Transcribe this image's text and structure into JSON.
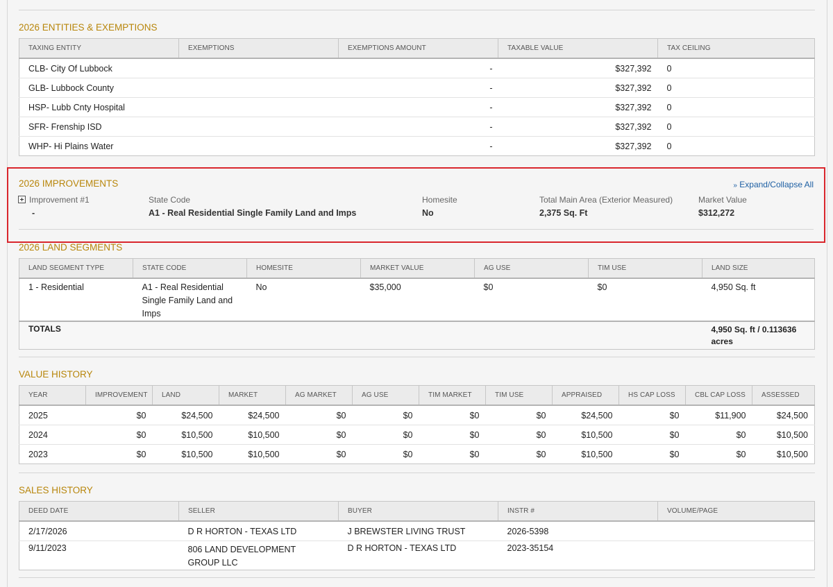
{
  "entities": {
    "title": "2026 ENTITIES & EXEMPTIONS",
    "headers": [
      "TAXING ENTITY",
      "EXEMPTIONS",
      "EXEMPTIONS AMOUNT",
      "TAXABLE VALUE",
      "TAX CEILING"
    ],
    "rows": [
      {
        "entity": "CLB- City Of Lubbock",
        "exemptions": "",
        "amount": "-",
        "taxable": "$327,392",
        "ceiling": "0"
      },
      {
        "entity": "GLB- Lubbock County",
        "exemptions": "",
        "amount": "-",
        "taxable": "$327,392",
        "ceiling": "0"
      },
      {
        "entity": "HSP- Lubb Cnty Hospital",
        "exemptions": "",
        "amount": "-",
        "taxable": "$327,392",
        "ceiling": "0"
      },
      {
        "entity": "SFR- Frenship ISD",
        "exemptions": "",
        "amount": "-",
        "taxable": "$327,392",
        "ceiling": "0"
      },
      {
        "entity": "WHP- Hi Plains Water",
        "exemptions": "",
        "amount": "-",
        "taxable": "$327,392",
        "ceiling": "0"
      }
    ]
  },
  "improvements": {
    "title": "2026 IMPROVEMENTS",
    "expand_label": "Expand/Collapse All",
    "fields": [
      {
        "label": "Improvement #1",
        "value": "-"
      },
      {
        "label": "State Code",
        "value": "A1 - Real Residential Single Family Land and Imps"
      },
      {
        "label": "Homesite",
        "value": "No"
      },
      {
        "label": "Total Main Area (Exterior Measured)",
        "value": "2,375 Sq. Ft"
      },
      {
        "label": "Market Value",
        "value": "$312,272"
      }
    ]
  },
  "land": {
    "title": "2026 LAND SEGMENTS",
    "headers": [
      "LAND SEGMENT TYPE",
      "STATE CODE",
      "HOMESITE",
      "MARKET VALUE",
      "AG USE",
      "TIM USE",
      "LAND SIZE"
    ],
    "rows": [
      {
        "type": "1 - Residential",
        "state_code": "A1 - Real Residential Single Family Land and Imps",
        "homesite": "No",
        "market": "$35,000",
        "ag": "$0",
        "tim": "$0",
        "size": "4,950 Sq. ft"
      }
    ],
    "totals_label": "TOTALS",
    "totals_value": "4,950 Sq. ft / 0.113636 acres"
  },
  "value_history": {
    "title": "VALUE HISTORY",
    "headers": [
      "YEAR",
      "IMPROVEMENT",
      "LAND",
      "MARKET",
      "AG MARKET",
      "AG USE",
      "TIM MARKET",
      "TIM USE",
      "APPRAISED",
      "HS CAP LOSS",
      "CBL CAP LOSS",
      "ASSESSED"
    ],
    "rows": [
      [
        "2025",
        "$0",
        "$24,500",
        "$24,500",
        "$0",
        "$0",
        "$0",
        "$0",
        "$24,500",
        "$0",
        "$11,900",
        "$24,500"
      ],
      [
        "2024",
        "$0",
        "$10,500",
        "$10,500",
        "$0",
        "$0",
        "$0",
        "$0",
        "$10,500",
        "$0",
        "$0",
        "$10,500"
      ],
      [
        "2023",
        "$0",
        "$10,500",
        "$10,500",
        "$0",
        "$0",
        "$0",
        "$0",
        "$10,500",
        "$0",
        "$0",
        "$10,500"
      ]
    ]
  },
  "sales": {
    "title": "SALES HISTORY",
    "headers": [
      "DEED DATE",
      "SELLER",
      "BUYER",
      "INSTR #",
      "VOLUME/PAGE"
    ],
    "rows": [
      {
        "date": "2/17/2026",
        "seller": "D R HORTON - TEXAS LTD",
        "buyer": "J BREWSTER LIVING TRUST",
        "instr": "2026-5398",
        "volume": ""
      },
      {
        "date": "9/11/2023",
        "seller": "806 LAND DEVELOPMENT GROUP LLC",
        "buyer": "D R HORTON - TEXAS LTD",
        "instr": "2023-35154",
        "volume": ""
      }
    ]
  }
}
